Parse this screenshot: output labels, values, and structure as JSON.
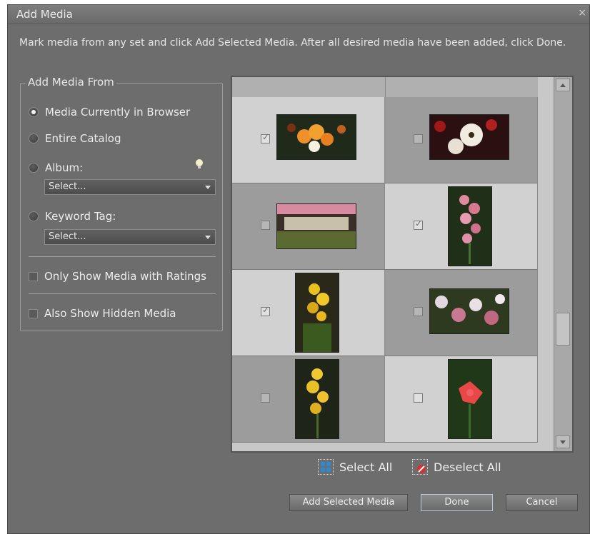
{
  "window": {
    "title": "Add Media",
    "close_icon": "×"
  },
  "instructions": "Mark media from any set and click Add Selected Media. After all desired media have been added, click Done.",
  "source_panel": {
    "legend": "Add Media From",
    "options": [
      {
        "label": "Media Currently in Browser",
        "selected": true
      },
      {
        "label": "Entire Catalog",
        "selected": false
      },
      {
        "label": "Album:",
        "selected": false
      },
      {
        "label": "Keyword Tag:",
        "selected": false
      }
    ],
    "album_select": "Select...",
    "keyword_select": "Select...",
    "only_ratings_label": "Only Show Media with Ratings",
    "hidden_media_label": "Also Show Hidden Media"
  },
  "grid": {
    "items": [
      {
        "name": "orange gerbera daisies",
        "checked": true
      },
      {
        "name": "white gerbera daisies",
        "checked": false
      },
      {
        "name": "garden flower bed",
        "checked": false
      },
      {
        "name": "pink orchid spray",
        "checked": true
      },
      {
        "name": "yellow orchid spray",
        "checked": true
      },
      {
        "name": "white and pink orchids",
        "checked": false
      },
      {
        "name": "yellow orchid spike",
        "checked": false
      },
      {
        "name": "red lily",
        "checked": false
      }
    ]
  },
  "selection": {
    "select_all": "Select All",
    "deselect_all": "Deselect All"
  },
  "buttons": {
    "add": "Add Selected Media",
    "done": "Done",
    "cancel": "Cancel"
  },
  "colors": {
    "dialog_bg": "#6d6d6d",
    "tile_light": "#d1d1d1",
    "tile_dark": "#9c9c9c"
  }
}
